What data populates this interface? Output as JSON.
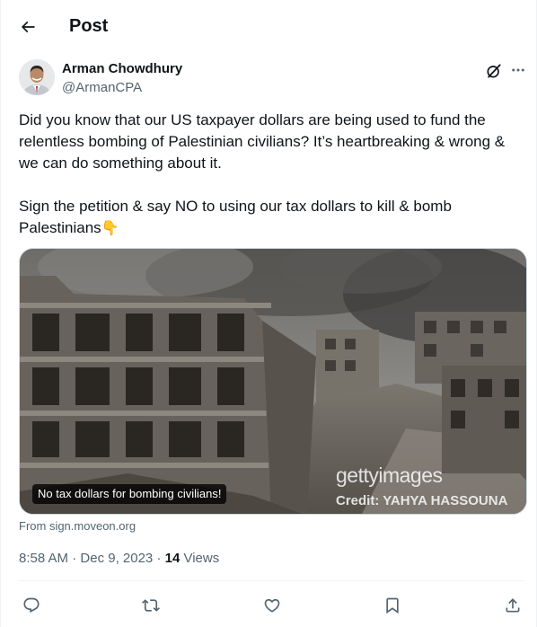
{
  "header": {
    "title": "Post",
    "back_icon": "arrow-left-icon"
  },
  "author": {
    "display_name": "Arman Chowdhury",
    "handle": "@ArmanCPA",
    "avatar_icon": "profile-photo"
  },
  "tweet": {
    "paragraph_1": "Did you know that our US taxpayer dollars are being used to fund the relentless bombing of Palestinian civilians? It’s heartbreaking & wrong & we can do something about it.",
    "paragraph_2": "Sign the petition & say NO to using our tax dollars to kill & bomb Palestinians",
    "emoji": "👇"
  },
  "media": {
    "caption": "No tax dollars for bombing civilians!",
    "watermark_brand": "gettyimages",
    "watermark_credit": "Credit: YAHYA HASSOUNA",
    "source": "From sign.moveon.org"
  },
  "meta": {
    "time": "8:58 AM",
    "separator": "·",
    "date": "Dec 9, 2023",
    "views_count": "14",
    "views_label": "Views"
  },
  "actions": [
    "reply-icon",
    "repost-icon",
    "like-icon",
    "bookmark-icon",
    "share-icon"
  ],
  "colors": {
    "text": "#0f1419",
    "secondary": "#536471",
    "border": "#eff3f4"
  }
}
